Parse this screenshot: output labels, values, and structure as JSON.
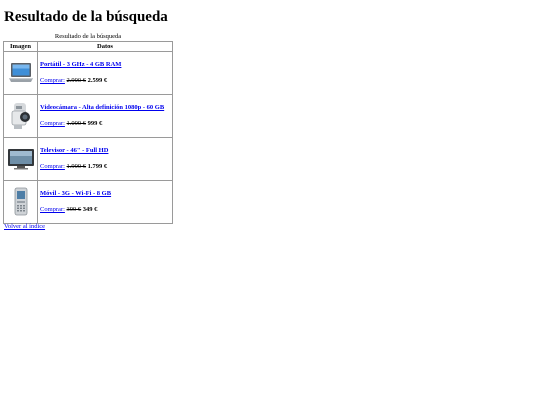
{
  "page": {
    "heading": "Resultado de la búsqueda"
  },
  "table": {
    "caption": "Resultado de la búsqueda",
    "headers": {
      "image": "Imagen",
      "data": "Datos"
    },
    "buy_label": "Comprar:",
    "products": [
      {
        "name": "Portátil - 3 GHz - 4 GB RAM",
        "old_price": "2.990 €",
        "new_price": "2.599 €",
        "icon": "laptop-icon"
      },
      {
        "name": "Videocámara - Alta definición 1080p - 60 GB",
        "old_price": "1.099 €",
        "new_price": "999 €",
        "icon": "camcorder-icon"
      },
      {
        "name": "Televisor - 46\" - Full HD",
        "old_price": "1.999 €",
        "new_price": "1.799 €",
        "icon": "television-icon"
      },
      {
        "name": "Móvil - 3G - Wi-Fi - 8 GB",
        "old_price": "399 €",
        "new_price": "349 €",
        "icon": "mobile-phone-icon"
      }
    ]
  },
  "footer": {
    "back_link": "Volver al índice"
  },
  "colors": {
    "link": "#0000ee",
    "border": "#9a9a9a"
  }
}
